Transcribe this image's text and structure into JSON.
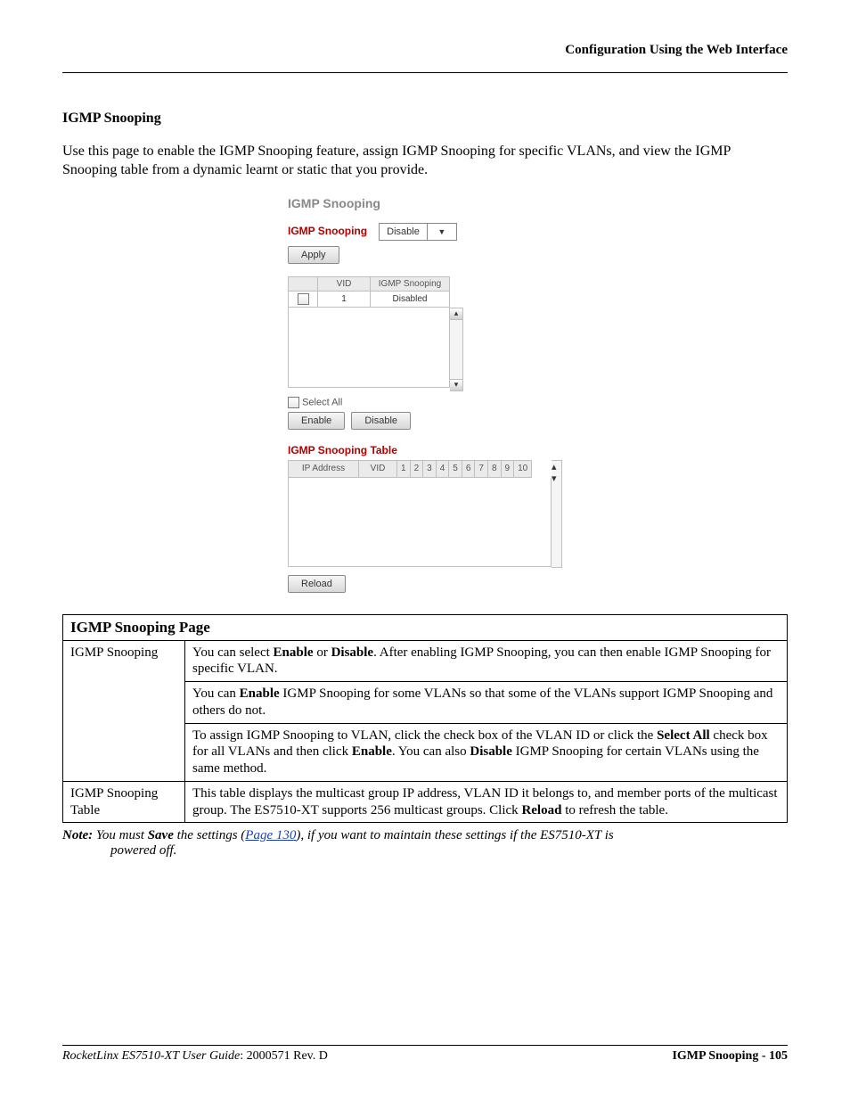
{
  "header": {
    "right": "Configuration Using the Web Interface"
  },
  "section": {
    "title": "IGMP Snooping",
    "intro": "Use this page to enable the IGMP Snooping feature, assign IGMP Snooping for specific VLANs, and view the IGMP Snooping table from a dynamic learnt or static that you provide."
  },
  "shot": {
    "title": "IGMP Snooping",
    "setting_label": "IGMP Snooping",
    "setting_value": "Disable",
    "apply": "Apply",
    "vlan_cols": {
      "check": "",
      "vid": "VID",
      "snoop": "IGMP Snooping"
    },
    "vlan_row": {
      "vid": "1",
      "snoop": "Disabled"
    },
    "select_all": "Select All",
    "enable": "Enable",
    "disable": "Disable",
    "table_title": "IGMP Snooping Table",
    "table_cols": [
      "IP Address",
      "VID",
      "1",
      "2",
      "3",
      "4",
      "5",
      "6",
      "7",
      "8",
      "9",
      "10"
    ],
    "reload": "Reload"
  },
  "desc": {
    "title": "IGMP Snooping Page",
    "row1_label": "IGMP Snooping",
    "row1_a_pre": "You can select ",
    "row1_a_b1": "Enable",
    "row1_a_mid1": " or ",
    "row1_a_b2": "Disable",
    "row1_a_post": ". After enabling IGMP Snooping, you can then enable IGMP Snooping for specific VLAN.",
    "row1_b_pre": "You can ",
    "row1_b_b1": "Enable",
    "row1_b_post": " IGMP Snooping for some VLANs so that some of the VLANs support IGMP Snooping and others do not.",
    "row1_c_pre": "To assign IGMP Snooping to VLAN, click the check box of the VLAN ID or click the ",
    "row1_c_b1": "Select All",
    "row1_c_mid1": " check box for all VLANs and then click ",
    "row1_c_b2": "Enable",
    "row1_c_mid2": ". You can also ",
    "row1_c_b3": "Disable",
    "row1_c_post": " IGMP Snooping for certain VLANs using the same method.",
    "row2_label": "IGMP Snooping Table",
    "row2_pre": "This table displays the multicast group IP address, VLAN ID it belongs to, and member ports of the multicast group. The ES7510-XT supports 256 multicast groups. Click ",
    "row2_b1": "Reload",
    "row2_post": " to refresh the table."
  },
  "note": {
    "label": "Note:",
    "body_pre": " You must ",
    "save": "Save",
    "body_mid": " the settings (",
    "link": "Page 130",
    "body_post": "), if you want to maintain these settings if the ES7510-XT is",
    "body_line2": "powered off."
  },
  "footer": {
    "left_italic": "RocketLinx ES7510-XT  User Guide",
    "left_rest": ": 2000571 Rev. D",
    "right": "IGMP Snooping - 105"
  }
}
